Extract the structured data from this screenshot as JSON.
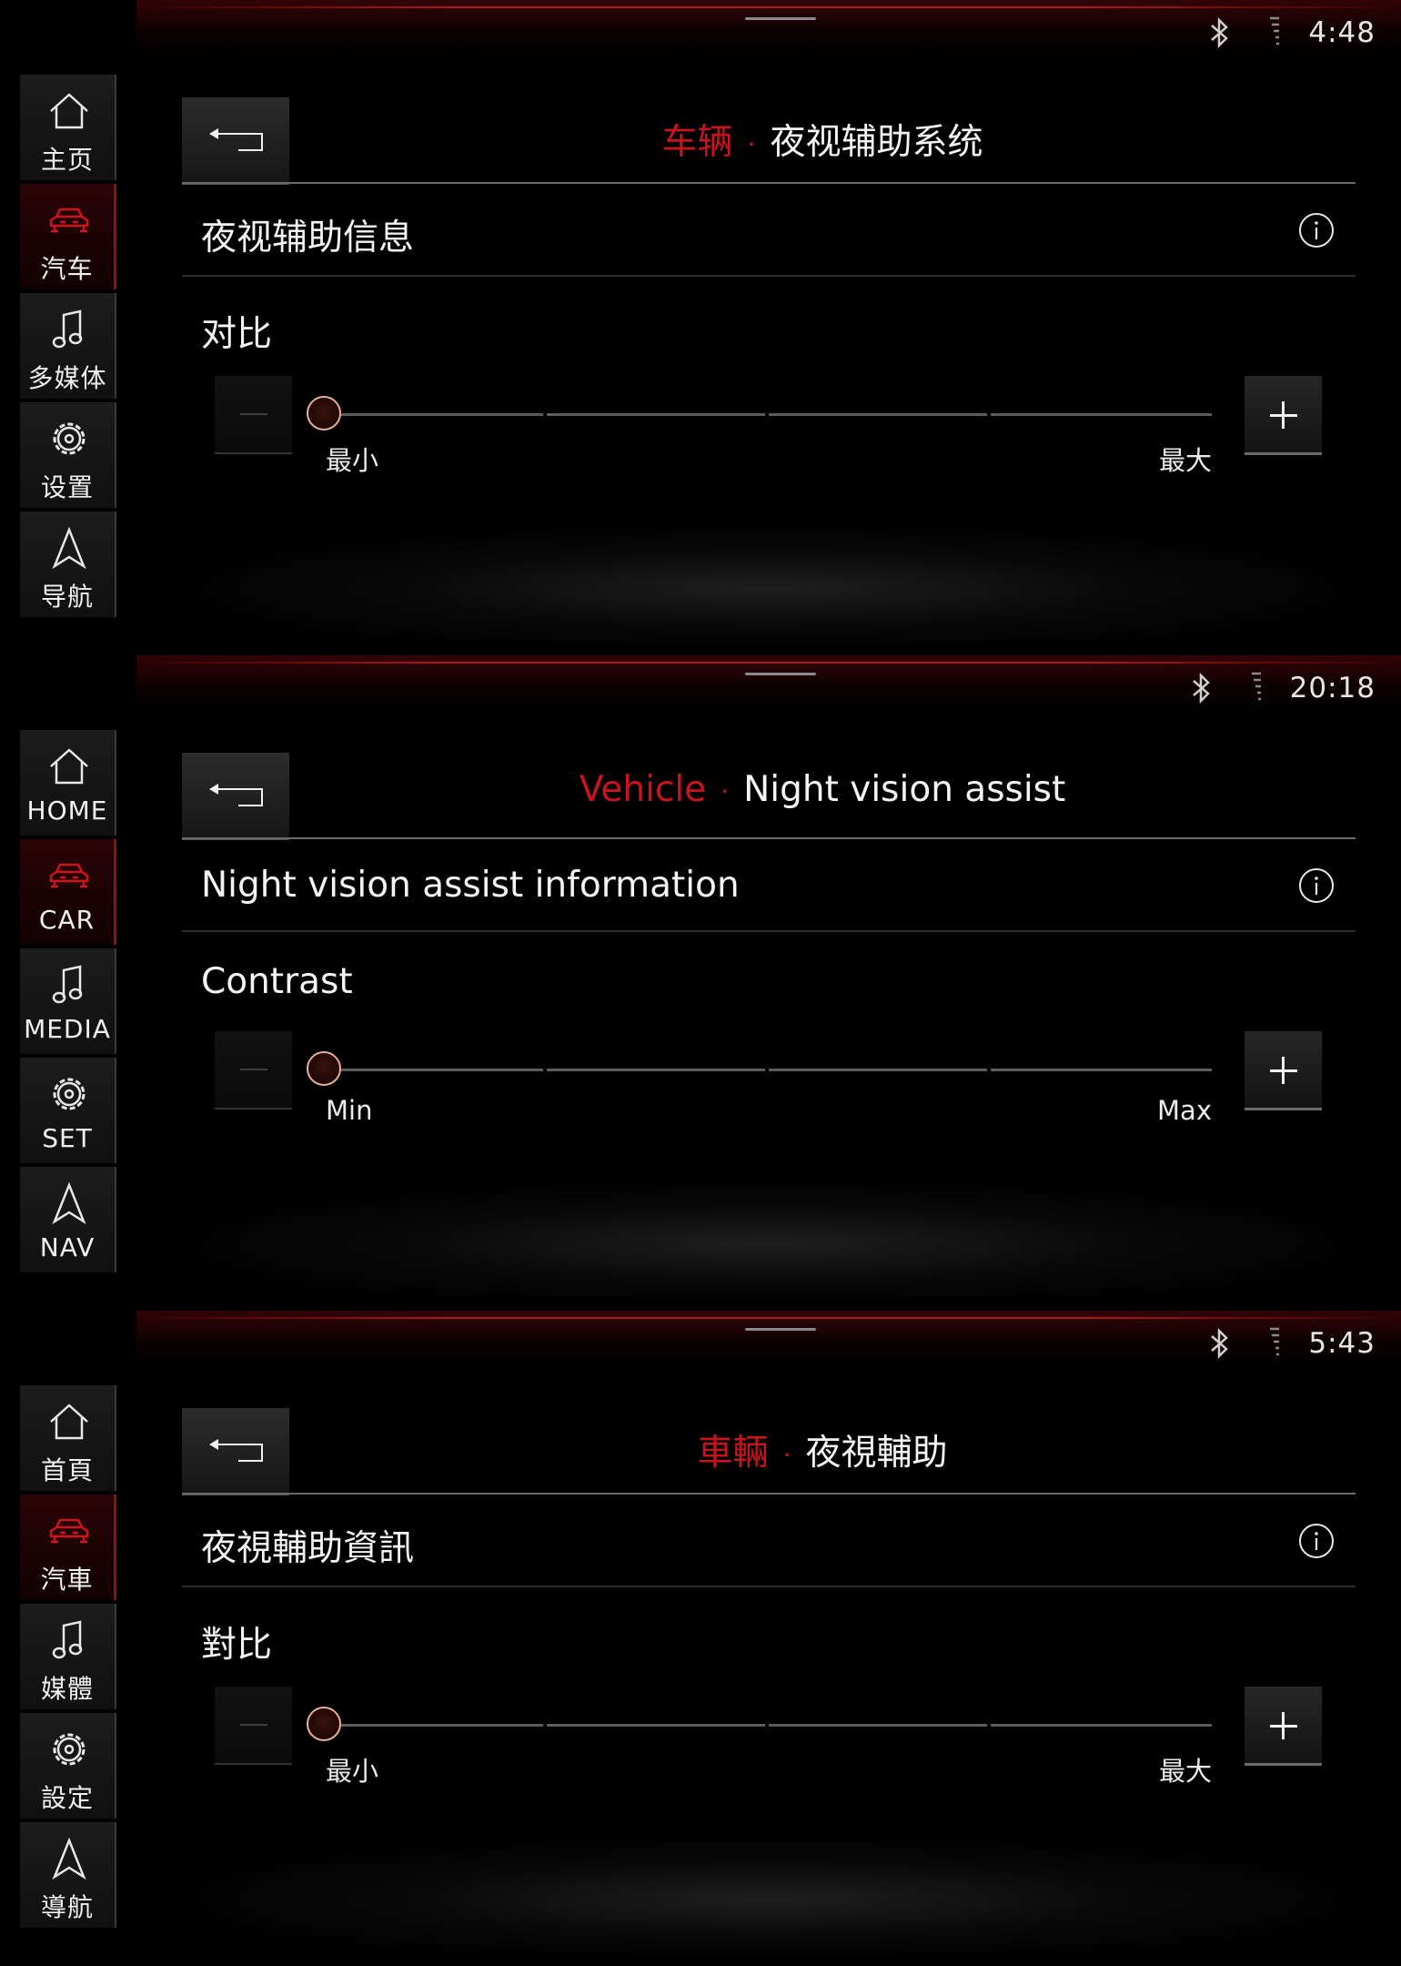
{
  "colors": {
    "accent": "#c8141e",
    "text": "#f4f4f4",
    "background": "#000000"
  },
  "screens": [
    {
      "status": {
        "bluetooth_icon": "bluetooth-icon",
        "signal_icon": "signal-icon",
        "time": "4:48"
      },
      "sidebar": [
        {
          "icon": "home-icon",
          "label": "主页"
        },
        {
          "icon": "car-icon",
          "label": "汽车",
          "active": true
        },
        {
          "icon": "music-note-icon",
          "label": "多媒体"
        },
        {
          "icon": "gear-icon",
          "label": "设置"
        },
        {
          "icon": "navigation-arrow-icon",
          "label": "导航"
        }
      ],
      "header": {
        "breadcrumb_parent": "车辆",
        "separator": "·",
        "title": "夜视辅助系统"
      },
      "info_row": {
        "label": "夜视辅助信息"
      },
      "contrast": {
        "label": "对比",
        "min_label": "最小",
        "max_label": "最大",
        "value": 0
      }
    },
    {
      "status": {
        "bluetooth_icon": "bluetooth-icon",
        "signal_icon": "signal-icon",
        "time": "20:18"
      },
      "sidebar": [
        {
          "icon": "home-icon",
          "label": "HOME"
        },
        {
          "icon": "car-icon",
          "label": "CAR",
          "active": true
        },
        {
          "icon": "music-note-icon",
          "label": "MEDIA"
        },
        {
          "icon": "gear-icon",
          "label": "SET"
        },
        {
          "icon": "navigation-arrow-icon",
          "label": "NAV"
        }
      ],
      "header": {
        "breadcrumb_parent": "Vehicle",
        "separator": "·",
        "title": "Night vision assist"
      },
      "info_row": {
        "label": "Night vision assist information"
      },
      "contrast": {
        "label": "Contrast",
        "min_label": "Min",
        "max_label": "Max",
        "value": 0
      }
    },
    {
      "status": {
        "bluetooth_icon": "bluetooth-icon",
        "signal_icon": "signal-icon",
        "time": "5:43"
      },
      "sidebar": [
        {
          "icon": "home-icon",
          "label": "首頁"
        },
        {
          "icon": "car-icon",
          "label": "汽車",
          "active": true
        },
        {
          "icon": "music-note-icon",
          "label": "媒體"
        },
        {
          "icon": "gear-icon",
          "label": "設定"
        },
        {
          "icon": "navigation-arrow-icon",
          "label": "導航"
        }
      ],
      "header": {
        "breadcrumb_parent": "車輛",
        "separator": "·",
        "title": "夜視輔助"
      },
      "info_row": {
        "label": "夜視輔助資訊"
      },
      "contrast": {
        "label": "對比",
        "min_label": "最小",
        "max_label": "最大",
        "value": 0
      }
    }
  ]
}
